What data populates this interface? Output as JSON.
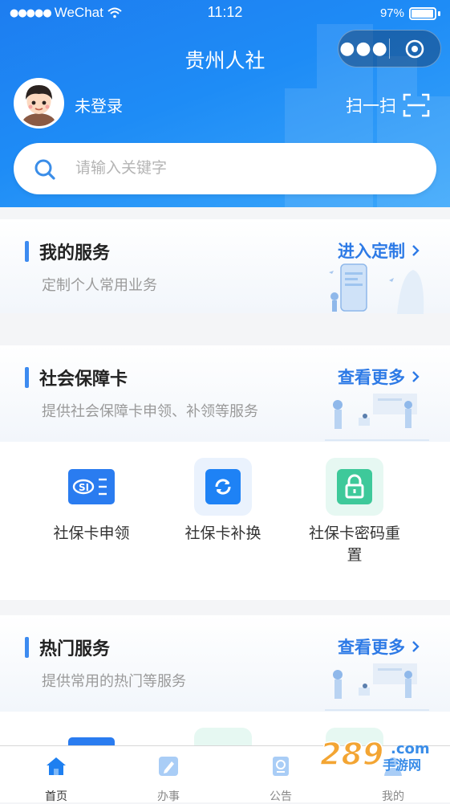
{
  "status_bar": {
    "carrier": "WeChat",
    "time": "11:12",
    "battery": "97%",
    "battery_level": 0.97
  },
  "header": {
    "title": "贵州人社",
    "login_text": "未登录",
    "scan_label": "扫一扫"
  },
  "search": {
    "placeholder": "请输入关键字"
  },
  "my_services": {
    "title": "我的服务",
    "subtitle": "定制个人常用业务",
    "link": "进入定制"
  },
  "social_card": {
    "title": "社会保障卡",
    "subtitle": "提供社会保障卡申领、补领等服务",
    "link": "查看更多",
    "items": [
      {
        "label": "社保卡申领",
        "icon": "social-card-icon"
      },
      {
        "label": "社保卡补换",
        "icon": "refresh-icon"
      },
      {
        "label": "社保卡密码重置",
        "icon": "lock-icon"
      }
    ]
  },
  "hot_services": {
    "title": "热门服务",
    "subtitle": "提供常用的热门等服务",
    "link": "查看更多"
  },
  "tabbar": {
    "items": [
      {
        "label": "首页",
        "icon": "home-icon",
        "active": true
      },
      {
        "label": "办事",
        "icon": "edit-icon",
        "active": false
      },
      {
        "label": "公告",
        "icon": "notice-icon",
        "active": false
      },
      {
        "label": "我的",
        "icon": "user-icon",
        "active": false
      }
    ]
  },
  "colors": {
    "primary": "#1e88f5",
    "link": "#2d7ae6",
    "accent_bar": "#3d8bf0",
    "green": "#3ec99a"
  }
}
